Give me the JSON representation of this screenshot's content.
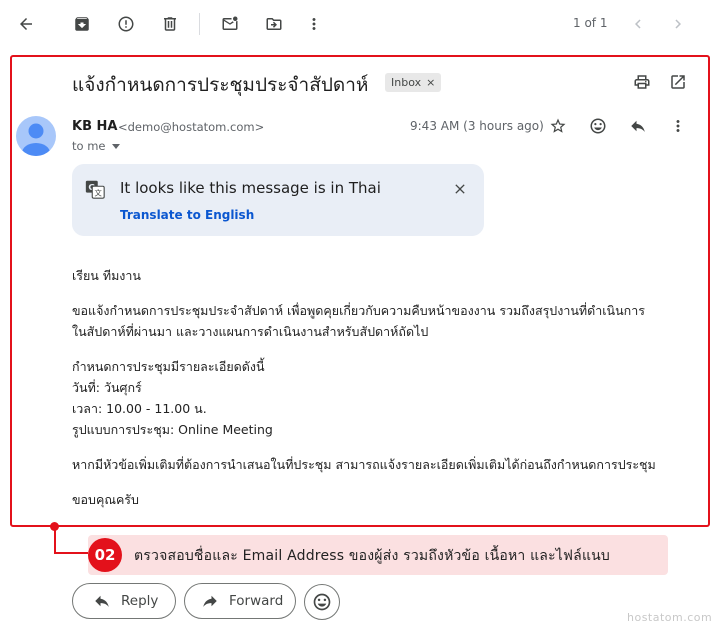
{
  "toolbar": {
    "icons": [
      "back-arrow-icon",
      "archive-icon",
      "report-spam-icon",
      "delete-icon",
      "mark-unread-icon",
      "move-to-icon",
      "more-vert-icon"
    ],
    "pager_text": "1 of 1"
  },
  "email": {
    "subject": "แจ้งกำหนดการประชุมประจำสัปดาห์",
    "label": "Inbox",
    "label_remove": "×",
    "sender_name": "KB HA",
    "sender_email": "<demo@hostatom.com>",
    "to": "to me",
    "timestamp": "9:43 AM (3 hours ago)"
  },
  "translate": {
    "message": "It looks like this message is in Thai",
    "link": "Translate to English"
  },
  "body": {
    "greeting": "เรียน ทีมงาน",
    "para1_line1": "ขอแจ้งกำหนดการประชุมประจำสัปดาห์ เพื่อพูดคุยเกี่ยวกับความคืบหน้าของงาน รวมถึงสรุปงานที่ดำเนินการ",
    "para1_line2": "ในสัปดาห์ที่ผ่านมา และวางแผนการดำเนินงานสำหรับสัปดาห์ถัดไป",
    "details_intro": "กำหนดการประชุมมีรายละเอียดดังนี้",
    "date_line": "วันที่: วันศุกร์",
    "time_line": "เวลา: 10.00 - 11.00 น.",
    "format_line": "รูปแบบการประชุม: Online Meeting",
    "para3": "หากมีหัวข้อเพิ่มเติมที่ต้องการนำเสนอในที่ประชุม สามารถแจ้งรายละเอียดเพิ่มเติมได้ก่อนถึงกำหนดการประชุม",
    "closing": "ขอบคุณครับ"
  },
  "callout": {
    "number": "02",
    "text": "ตรวจสอบชื่อและ Email Address ของผู้ส่ง รวมถึงหัวข้อ เนื้อหา และไฟล์แนบ",
    "color": "#e3111b",
    "bg": "#fbe0e1"
  },
  "actions": {
    "reply": "Reply",
    "forward": "Forward"
  },
  "watermark": "hostatom.com"
}
